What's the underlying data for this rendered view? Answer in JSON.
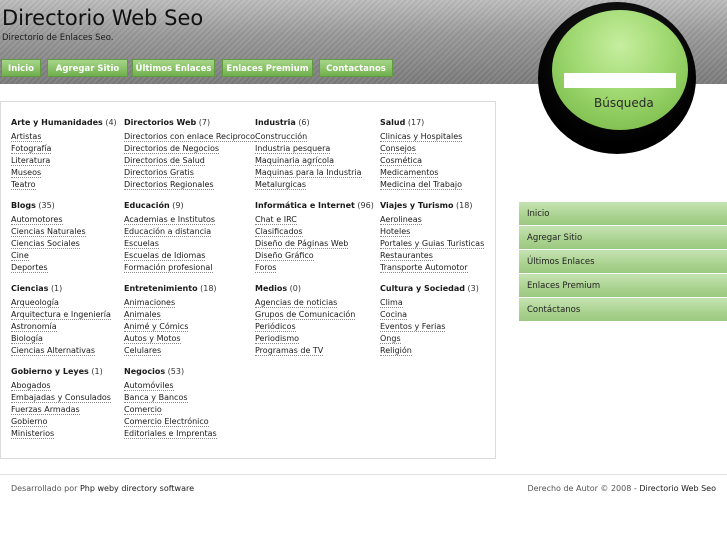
{
  "site": {
    "title": "Directorio Web Seo",
    "subtitle": "Directorio de Enlaces Seo."
  },
  "topnav": [
    "Inicio",
    "Agregar Sitio",
    "Últimos Enlaces",
    "Enlaces Premium",
    "Contactanos"
  ],
  "search": {
    "button_label": "Búsqueda",
    "value": ""
  },
  "sidenav": [
    "Inicio",
    "Agregar Sitio",
    "Últimos Enlaces",
    "Enlaces Premium",
    "Contáctanos"
  ],
  "categories": [
    {
      "title": "Arte y Humanidades",
      "count": "(4)",
      "links": [
        "Artistas",
        "Fotografía",
        "Literatura",
        "Museos",
        "Teatro"
      ]
    },
    {
      "title": "Directorios Web",
      "count": "(7)",
      "links": [
        "Directorios con enlace Reciproco",
        "Directorios de Negocios",
        "Directorios de Salud",
        "Directorios Gratis",
        "Directorios Regionales"
      ]
    },
    {
      "title": "Industria",
      "count": "(6)",
      "links": [
        "Construcción",
        "Industria pesquera",
        "Maquinaria agrícola",
        "Maquinas para la Industria",
        "Metalurgicas"
      ]
    },
    {
      "title": "Salud",
      "count": "(17)",
      "links": [
        "Clinicas y Hospitales",
        "Consejos",
        "Cosmética",
        "Medicamentos",
        "Medicina del Trabajo"
      ]
    },
    {
      "title": "Blogs",
      "count": "(35)",
      "links": [
        "Automotores",
        "Ciencias Naturales",
        "Ciencias Sociales",
        "Cine",
        "Deportes"
      ]
    },
    {
      "title": "Educación",
      "count": "(9)",
      "links": [
        "Academias e Institutos",
        "Educación a distancia",
        "Escuelas",
        "Escuelas de Idiomas",
        "Formación profesional"
      ]
    },
    {
      "title": "Informática e Internet",
      "count": "(96)",
      "links": [
        "Chat e IRC",
        "Clasificados",
        "Diseño de Páginas Web",
        "Diseño Gráfico",
        "Foros"
      ]
    },
    {
      "title": "Viajes y Turismo",
      "count": "(18)",
      "links": [
        "Aerolineas",
        "Hoteles",
        "Portales y Guias Turisticas",
        "Restaurantes",
        "Transporte Automotor"
      ]
    },
    {
      "title": "Ciencias",
      "count": "(1)",
      "links": [
        "Arqueología",
        "Arquitectura e Ingeniería",
        "Astronomía",
        "Biología",
        "Ciencias Alternativas"
      ]
    },
    {
      "title": "Entretenimiento",
      "count": "(18)",
      "links": [
        "Animaciones",
        "Animales",
        "Animé y Cómics",
        "Autos y Motos",
        "Celulares"
      ]
    },
    {
      "title": "Medios",
      "count": "(0)",
      "links": [
        "Agencias de noticias",
        "Grupos de Comunicación",
        "Periódicos",
        "Periodismo",
        "Programas de TV"
      ]
    },
    {
      "title": "Cultura y Sociedad",
      "count": "(3)",
      "links": [
        "Clima",
        "Cocina",
        "Eventos y Ferias",
        "Ongs",
        "Religión"
      ]
    },
    {
      "title": "Gobierno y Leyes",
      "count": "(1)",
      "links": [
        "Abogados",
        "Embajadas y Consulados",
        "Fuerzas Armadas",
        "Gobierno",
        "Ministerios"
      ]
    },
    {
      "title": "Negocios",
      "count": "(53)",
      "links": [
        "Automóviles",
        "Banca y Bancos",
        "Comercio",
        "Comercio Electrónico",
        "Editoriales e Imprentas"
      ]
    }
  ],
  "footer": {
    "left_prefix": "Desarrollado por",
    "left_link": "Php weby directory software",
    "right_prefix": "Derecho de Autor © 2008 -",
    "right_link": "Directorio Web Seo"
  }
}
